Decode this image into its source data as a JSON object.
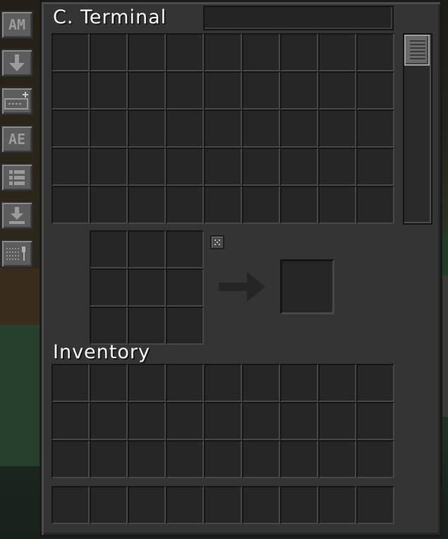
{
  "terminal": {
    "title": "C. Terminal",
    "search": {
      "value": ""
    }
  },
  "side_buttons": [
    {
      "name": "access-mode-button",
      "label": "AM",
      "icon": "text"
    },
    {
      "name": "sort-direction-button",
      "label": "",
      "icon": "down-arrow-icon"
    },
    {
      "name": "search-mode-button",
      "label": "",
      "icon": "search-box-plus-icon"
    },
    {
      "name": "view-mode-button",
      "label": "AE",
      "icon": "text"
    },
    {
      "name": "sort-by-button",
      "label": "",
      "icon": "list-icon"
    },
    {
      "name": "deposit-button",
      "label": "",
      "icon": "deposit-icon"
    },
    {
      "name": "terminal-style-button",
      "label": "",
      "icon": "grid-pin-icon"
    }
  ],
  "inventory": {
    "label": "Inventory"
  },
  "colors": {
    "panel": "#343434",
    "slot": "#262626",
    "text": "#f4f4f4"
  }
}
